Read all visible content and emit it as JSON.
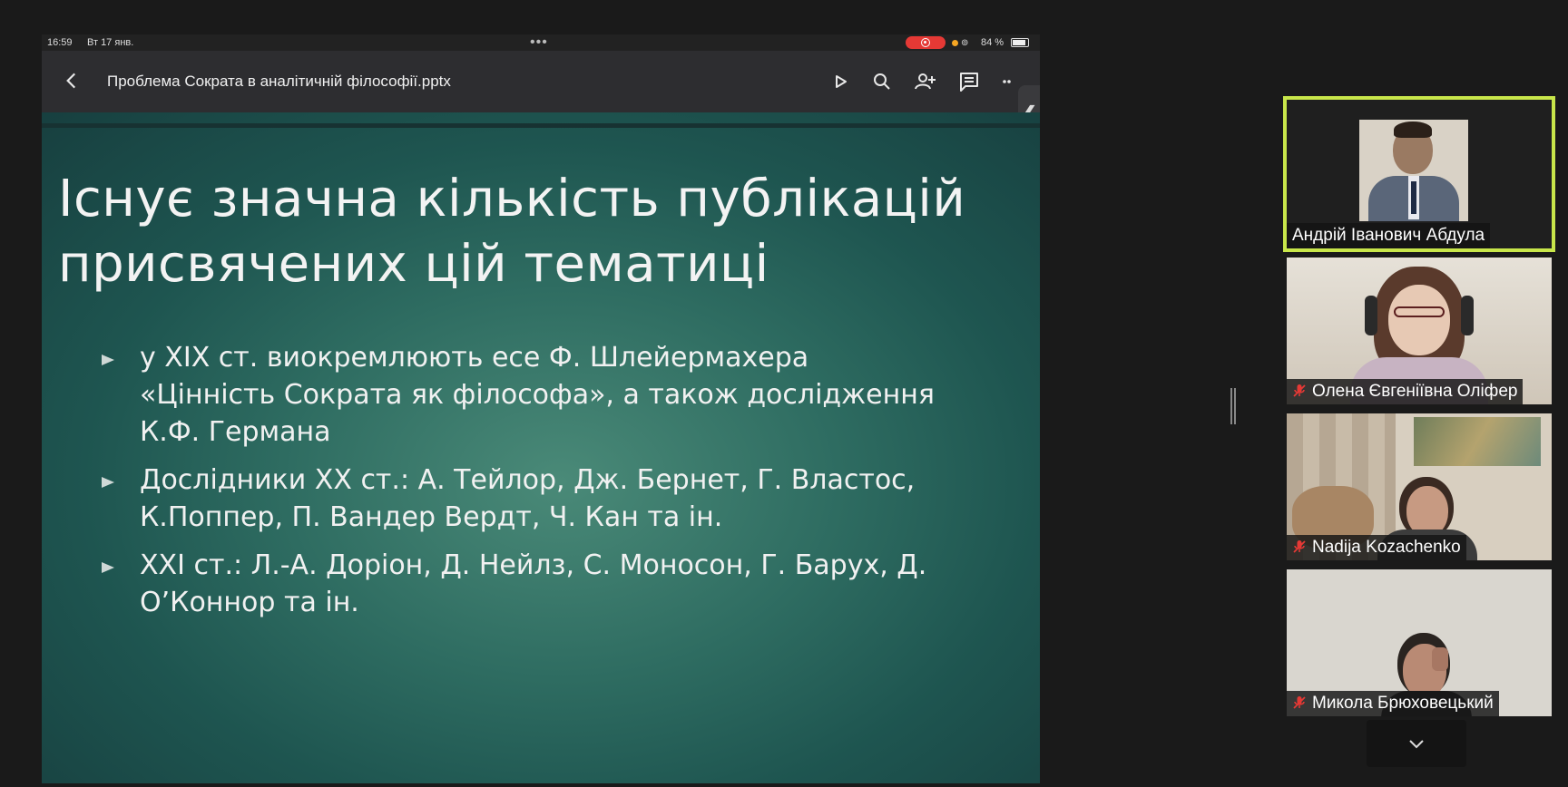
{
  "status_bar": {
    "time": "16:59",
    "date": "Вт 17 янв.",
    "battery": "84 %",
    "recording_color": "#e53935"
  },
  "toolbar": {
    "document_title": "Проблема Сократа в аналітичній філософії.pptx",
    "icons": [
      "back-icon",
      "play-icon",
      "search-icon",
      "add-person-icon",
      "comment-icon",
      "more-icon"
    ]
  },
  "slide": {
    "title_lines": [
      "Існує значна кількість публікацій",
      "присвячених цій тематиці"
    ],
    "bullets": [
      {
        "lines": [
          "у XIX ст. виокремлюють есе Ф. Шлейермахера",
          "«Цінність Сократа як філософа», а також дослідження",
          "К.Ф. Германа"
        ]
      },
      {
        "lines": [
          "Дослідники XX ст.: А. Тейлор, Дж. Бернет, Г. Властос,",
          "К.Поппер, П. Вандер Вердт, Ч. Кан та ін."
        ]
      },
      {
        "lines": [
          "XXI ст.: Л.-А. Доріон, Д. Нейлз, С. Моносон, Г. Барух, Д.",
          "О’Коннор  та ін."
        ]
      }
    ],
    "accent_color": "#2e6c61"
  },
  "participants": [
    {
      "name": "Андрій Іванович Абдула",
      "muted": false,
      "active": true,
      "highlight_color": "#c8e64a"
    },
    {
      "name": "Олена Євгеніївна Оліфер",
      "muted": true,
      "active": false
    },
    {
      "name": "Nadija Kozachenko",
      "muted": true,
      "active": false
    },
    {
      "name": "Микола Брюховецький",
      "muted": true,
      "active": false
    }
  ]
}
